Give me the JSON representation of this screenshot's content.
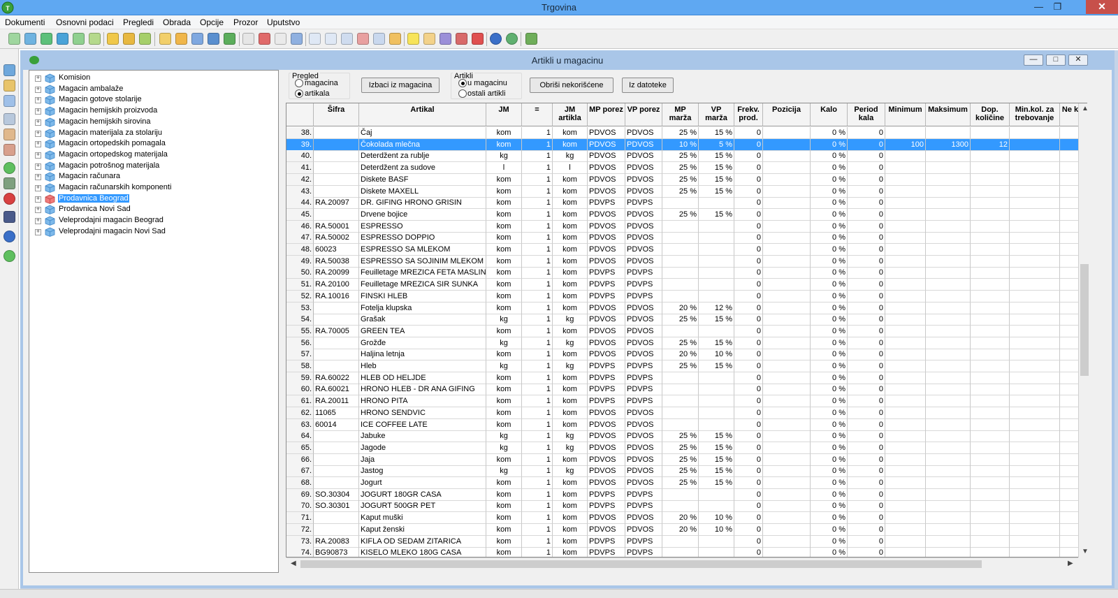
{
  "window": {
    "title": "Trgovina",
    "min": "—",
    "max": "❐",
    "close": "✕"
  },
  "menu": [
    "Dokumenti",
    "Osnovni podaci",
    "Pregledi",
    "Obrada",
    "Opcije",
    "Prozor",
    "Uputstvo"
  ],
  "child": {
    "title": "Artikli u magacinu",
    "min": "—",
    "max": "□",
    "close": "✕"
  },
  "tree": {
    "items": [
      {
        "label": "Komision",
        "selected": false
      },
      {
        "label": "Magacin ambalaže",
        "selected": false
      },
      {
        "label": "Magacin gotove stolarije",
        "selected": false
      },
      {
        "label": "Magacin hemijskih proizvoda",
        "selected": false
      },
      {
        "label": "Magacin hemijskih sirovina",
        "selected": false
      },
      {
        "label": "Magacin materijala za stolariju",
        "selected": false
      },
      {
        "label": "Magacin ortopedskih pomagala",
        "selected": false
      },
      {
        "label": "Magacin ortopedskog materijala",
        "selected": false
      },
      {
        "label": "Magacin potrošnog materijala",
        "selected": false
      },
      {
        "label": "Magacin računara",
        "selected": false
      },
      {
        "label": "Magacin računarskih komponenti",
        "selected": false
      },
      {
        "label": "Prodavnica Beograd",
        "selected": true
      },
      {
        "label": "Prodavnica Novi Sad",
        "selected": false
      },
      {
        "label": "Veleprodajni magacin Beograd",
        "selected": false
      },
      {
        "label": "Veleprodajni magacin Novi Sad",
        "selected": false
      }
    ]
  },
  "filters": {
    "pregled": {
      "caption": "Pregled",
      "opt1": "magacina",
      "opt2": "artikala",
      "selected": "artikala"
    },
    "artikli": {
      "caption": "Artikli",
      "opt1": "u magacinu",
      "opt2": "ostali artikli",
      "selected": "u magacinu"
    },
    "btn_izbaci": "Izbaci iz magacina",
    "btn_obrisi": "Obriši nekorišćene",
    "btn_datoteka": "Iz datoteke"
  },
  "grid": {
    "columns": [
      {
        "key": "num",
        "label": ""
      },
      {
        "key": "sifra",
        "label": "Šifra"
      },
      {
        "key": "artikal",
        "label": "Artikal"
      },
      {
        "key": "jm",
        "label": "JM"
      },
      {
        "key": "eq",
        "label": "="
      },
      {
        "key": "jma",
        "label": "JM\nartikla"
      },
      {
        "key": "mpp",
        "label": "MP porez"
      },
      {
        "key": "vpp",
        "label": "VP porez"
      },
      {
        "key": "mpm",
        "label": "MP\nmarža"
      },
      {
        "key": "vpm",
        "label": "VP\nmarža"
      },
      {
        "key": "frek",
        "label": "Frekv.\nprod."
      },
      {
        "key": "poz",
        "label": "Pozicija"
      },
      {
        "key": "kalo",
        "label": "Kalo"
      },
      {
        "key": "per",
        "label": "Period\nkala"
      },
      {
        "key": "min",
        "label": "Minimum"
      },
      {
        "key": "max",
        "label": "Maksimum"
      },
      {
        "key": "dop",
        "label": "Dop.\nkoličine"
      },
      {
        "key": "mink",
        "label": "Min.kol. za\ntrebovanje"
      },
      {
        "key": "ne",
        "label": "Ne k"
      }
    ],
    "rows": [
      [
        "38.",
        "",
        "Čaj",
        "kom",
        "1",
        "kom",
        "PDVOS",
        "PDVOS",
        "25 %",
        "15 %",
        "0",
        "",
        "0 %",
        "0",
        "",
        "",
        "",
        "",
        ""
      ],
      [
        "39.",
        "",
        "Čokolada mlečna",
        "kom",
        "1",
        "kom",
        "PDVOS",
        "PDVOS",
        "10 %",
        "5 %",
        "0",
        "",
        "0 %",
        "0",
        "100",
        "1300",
        "12",
        "",
        ""
      ],
      [
        "40.",
        "",
        "Deterdžent za rublje",
        "kg",
        "1",
        "kg",
        "PDVOS",
        "PDVOS",
        "25 %",
        "15 %",
        "0",
        "",
        "0 %",
        "0",
        "",
        "",
        "",
        "",
        ""
      ],
      [
        "41.",
        "",
        "Deterdžent za sudove",
        "l",
        "1",
        "l",
        "PDVOS",
        "PDVOS",
        "25 %",
        "15 %",
        "0",
        "",
        "0 %",
        "0",
        "",
        "",
        "",
        "",
        ""
      ],
      [
        "42.",
        "",
        "Diskete BASF",
        "kom",
        "1",
        "kom",
        "PDVOS",
        "PDVOS",
        "25 %",
        "15 %",
        "0",
        "",
        "0 %",
        "0",
        "",
        "",
        "",
        "",
        ""
      ],
      [
        "43.",
        "",
        "Diskete MAXELL",
        "kom",
        "1",
        "kom",
        "PDVOS",
        "PDVOS",
        "25 %",
        "15 %",
        "0",
        "",
        "0 %",
        "0",
        "",
        "",
        "",
        "",
        ""
      ],
      [
        "44.",
        "RA.20097",
        "DR. GIFING HRONO GRISIN",
        "kom",
        "1",
        "kom",
        "PDVPS",
        "PDVPS",
        "",
        "",
        "0",
        "",
        "0 %",
        "0",
        "",
        "",
        "",
        "",
        ""
      ],
      [
        "45.",
        "",
        "Drvene bojice",
        "kom",
        "1",
        "kom",
        "PDVOS",
        "PDVOS",
        "25 %",
        "15 %",
        "0",
        "",
        "0 %",
        "0",
        "",
        "",
        "",
        "",
        ""
      ],
      [
        "46.",
        "RA.50001",
        "ESPRESSO",
        "kom",
        "1",
        "kom",
        "PDVOS",
        "PDVOS",
        "",
        "",
        "0",
        "",
        "0 %",
        "0",
        "",
        "",
        "",
        "",
        ""
      ],
      [
        "47.",
        "RA.50002",
        "ESPRESSO DOPPIO",
        "kom",
        "1",
        "kom",
        "PDVOS",
        "PDVOS",
        "",
        "",
        "0",
        "",
        "0 %",
        "0",
        "",
        "",
        "",
        "",
        ""
      ],
      [
        "48.",
        "60023",
        "ESPRESSO SA MLEKOM",
        "kom",
        "1",
        "kom",
        "PDVOS",
        "PDVOS",
        "",
        "",
        "0",
        "",
        "0 %",
        "0",
        "",
        "",
        "",
        "",
        ""
      ],
      [
        "49.",
        "RA.50038",
        "ESPRESSO SA SOJINIM MLEKOM",
        "kom",
        "1",
        "kom",
        "PDVOS",
        "PDVOS",
        "",
        "",
        "0",
        "",
        "0 %",
        "0",
        "",
        "",
        "",
        "",
        ""
      ],
      [
        "50.",
        "RA.20099",
        "Feuilletage MREZICA FETA MASLINE",
        "kom",
        "1",
        "kom",
        "PDVPS",
        "PDVPS",
        "",
        "",
        "0",
        "",
        "0 %",
        "0",
        "",
        "",
        "",
        "",
        ""
      ],
      [
        "51.",
        "RA.20100",
        "Feuilletage MREZICA SIR SUNKA",
        "kom",
        "1",
        "kom",
        "PDVPS",
        "PDVPS",
        "",
        "",
        "0",
        "",
        "0 %",
        "0",
        "",
        "",
        "",
        "",
        ""
      ],
      [
        "52.",
        "RA.10016",
        "FINSKI HLEB",
        "kom",
        "1",
        "kom",
        "PDVPS",
        "PDVPS",
        "",
        "",
        "0",
        "",
        "0 %",
        "0",
        "",
        "",
        "",
        "",
        ""
      ],
      [
        "53.",
        "",
        "Fotelja klupska",
        "kom",
        "1",
        "kom",
        "PDVOS",
        "PDVOS",
        "20 %",
        "12 %",
        "0",
        "",
        "0 %",
        "0",
        "",
        "",
        "",
        "",
        ""
      ],
      [
        "54.",
        "",
        "Grašak",
        "kg",
        "1",
        "kg",
        "PDVOS",
        "PDVOS",
        "25 %",
        "15 %",
        "0",
        "",
        "0 %",
        "0",
        "",
        "",
        "",
        "",
        ""
      ],
      [
        "55.",
        "RA.70005",
        "GREEN TEA",
        "kom",
        "1",
        "kom",
        "PDVOS",
        "PDVOS",
        "",
        "",
        "0",
        "",
        "0 %",
        "0",
        "",
        "",
        "",
        "",
        ""
      ],
      [
        "56.",
        "",
        "Grožđe",
        "kg",
        "1",
        "kg",
        "PDVOS",
        "PDVOS",
        "25 %",
        "15 %",
        "0",
        "",
        "0 %",
        "0",
        "",
        "",
        "",
        "",
        ""
      ],
      [
        "57.",
        "",
        "Haljina letnja",
        "kom",
        "1",
        "kom",
        "PDVOS",
        "PDVOS",
        "20 %",
        "10 %",
        "0",
        "",
        "0 %",
        "0",
        "",
        "",
        "",
        "",
        ""
      ],
      [
        "58.",
        "",
        "Hleb",
        "kg",
        "1",
        "kg",
        "PDVPS",
        "PDVPS",
        "25 %",
        "15 %",
        "0",
        "",
        "0 %",
        "0",
        "",
        "",
        "",
        "",
        ""
      ],
      [
        "59.",
        "RA.60022",
        "HLEB OD HELJDE",
        "kom",
        "1",
        "kom",
        "PDVPS",
        "PDVPS",
        "",
        "",
        "0",
        "",
        "0 %",
        "0",
        "",
        "",
        "",
        "",
        ""
      ],
      [
        "60.",
        "RA.60021",
        "HRONO HLEB - DR ANA GIFING",
        "kom",
        "1",
        "kom",
        "PDVPS",
        "PDVPS",
        "",
        "",
        "0",
        "",
        "0 %",
        "0",
        "",
        "",
        "",
        "",
        ""
      ],
      [
        "61.",
        "RA.20011",
        "HRONO PITA",
        "kom",
        "1",
        "kom",
        "PDVPS",
        "PDVPS",
        "",
        "",
        "0",
        "",
        "0 %",
        "0",
        "",
        "",
        "",
        "",
        ""
      ],
      [
        "62.",
        "11065",
        "HRONO SENDVIC",
        "kom",
        "1",
        "kom",
        "PDVOS",
        "PDVOS",
        "",
        "",
        "0",
        "",
        "0 %",
        "0",
        "",
        "",
        "",
        "",
        ""
      ],
      [
        "63.",
        "60014",
        "ICE COFFEE LATE",
        "kom",
        "1",
        "kom",
        "PDVOS",
        "PDVOS",
        "",
        "",
        "0",
        "",
        "0 %",
        "0",
        "",
        "",
        "",
        "",
        ""
      ],
      [
        "64.",
        "",
        "Jabuke",
        "kg",
        "1",
        "kg",
        "PDVOS",
        "PDVOS",
        "25 %",
        "15 %",
        "0",
        "",
        "0 %",
        "0",
        "",
        "",
        "",
        "",
        ""
      ],
      [
        "65.",
        "",
        "Jagode",
        "kg",
        "1",
        "kg",
        "PDVOS",
        "PDVOS",
        "25 %",
        "15 %",
        "0",
        "",
        "0 %",
        "0",
        "",
        "",
        "",
        "",
        ""
      ],
      [
        "66.",
        "",
        "Jaja",
        "kom",
        "1",
        "kom",
        "PDVOS",
        "PDVOS",
        "25 %",
        "15 %",
        "0",
        "",
        "0 %",
        "0",
        "",
        "",
        "",
        "",
        ""
      ],
      [
        "67.",
        "",
        "Jastog",
        "kg",
        "1",
        "kg",
        "PDVOS",
        "PDVOS",
        "25 %",
        "15 %",
        "0",
        "",
        "0 %",
        "0",
        "",
        "",
        "",
        "",
        ""
      ],
      [
        "68.",
        "",
        "Jogurt",
        "kom",
        "1",
        "kom",
        "PDVOS",
        "PDVOS",
        "25 %",
        "15 %",
        "0",
        "",
        "0 %",
        "0",
        "",
        "",
        "",
        "",
        ""
      ],
      [
        "69.",
        "SO.30304",
        "JOGURT 180GR CASA",
        "kom",
        "1",
        "kom",
        "PDVPS",
        "PDVPS",
        "",
        "",
        "0",
        "",
        "0 %",
        "0",
        "",
        "",
        "",
        "",
        ""
      ],
      [
        "70.",
        "SO.30301",
        "JOGURT 500GR PET",
        "kom",
        "1",
        "kom",
        "PDVPS",
        "PDVPS",
        "",
        "",
        "0",
        "",
        "0 %",
        "0",
        "",
        "",
        "",
        "",
        ""
      ],
      [
        "71.",
        "",
        "Kaput muški",
        "kom",
        "1",
        "kom",
        "PDVOS",
        "PDVOS",
        "20 %",
        "10 %",
        "0",
        "",
        "0 %",
        "0",
        "",
        "",
        "",
        "",
        ""
      ],
      [
        "72.",
        "",
        "Kaput ženski",
        "kom",
        "1",
        "kom",
        "PDVOS",
        "PDVOS",
        "20 %",
        "10 %",
        "0",
        "",
        "0 %",
        "0",
        "",
        "",
        "",
        "",
        ""
      ],
      [
        "73.",
        "RA.20083",
        "KIFLA OD SEDAM ZITARICA",
        "kom",
        "1",
        "kom",
        "PDVPS",
        "PDVPS",
        "",
        "",
        "0",
        "",
        "0 %",
        "0",
        "",
        "",
        "",
        "",
        ""
      ],
      [
        "74.",
        "BG90873",
        "KISELO MLEKO 180G CASA",
        "kom",
        "1",
        "kom",
        "PDVPS",
        "PDVPS",
        "",
        "",
        "0",
        "",
        "0 %",
        "0",
        "",
        "",
        "",
        "",
        ""
      ]
    ],
    "selected_row": 1
  },
  "toolbar_icons": [
    "new-icon",
    "open-icon",
    "refresh-icon",
    "import-icon",
    "export-icon",
    "calc-icon",
    "folder-icon",
    "folder-arrow-icon",
    "folder-open-icon",
    "edit-icon",
    "write-icon",
    "write-blue-icon",
    "book-icon",
    "list-icon",
    "chart-icon",
    "sum-icon",
    "grid-icon",
    "table-icon",
    "columns-icon",
    "windows-icon",
    "form-icon",
    "report-icon",
    "bulb-icon",
    "tag-icon",
    "gear-icon",
    "dollar-icon",
    "filter-icon",
    "help-icon",
    "globe-icon",
    "exit-icon"
  ],
  "leftbar_icons": [
    "save-icon",
    "layout-icon",
    "table-icon",
    "print-icon",
    "users-icon",
    "users-key-icon",
    "add-icon",
    "tree-icon",
    "remove-icon",
    "binoculars-icon",
    "help-icon",
    "refresh-icon"
  ],
  "colors": {
    "selection": "#3399ff",
    "titlebar": "#5fa8f2",
    "child_frame": "#a9c6e8"
  }
}
